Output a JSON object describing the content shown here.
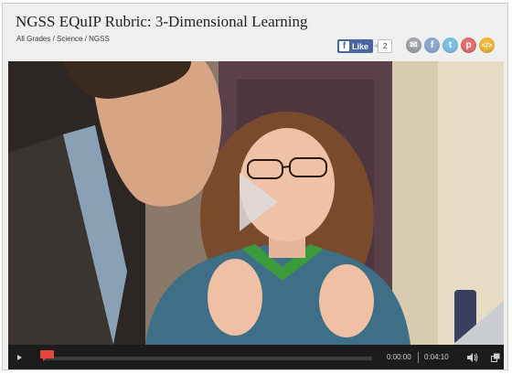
{
  "header": {
    "title": "NGSS EQuIP Rubric: 3-Dimensional Learning",
    "breadcrumb": "All Grades / Science / NGSS"
  },
  "facebook": {
    "like_label": "Like",
    "like_count": "2"
  },
  "share_icons": [
    "email-icon",
    "facebook-icon",
    "twitter-icon",
    "pinterest-icon",
    "embed-icon"
  ],
  "share_glyphs": {
    "email": "✉",
    "facebook": "f",
    "twitter": "t",
    "pinterest": "p",
    "embed": "</>"
  },
  "player": {
    "current_time": "0:00:00",
    "duration": "0:04:10",
    "progress": 0.0
  },
  "colors": {
    "facebook_blue": "#4a66a0",
    "progress_handle": "#e3463a",
    "control_bar": "#1c1c1c"
  }
}
